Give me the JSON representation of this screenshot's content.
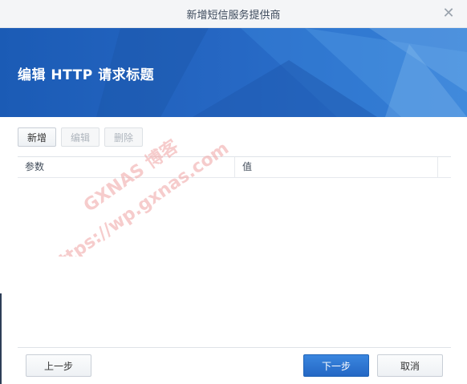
{
  "window": {
    "title": "新增短信服务提供商",
    "close_icon": "close-icon"
  },
  "banner": {
    "heading": "编辑 HTTP 请求标题"
  },
  "toolbar": {
    "add_label": "新增",
    "edit_label": "编辑",
    "delete_label": "删除"
  },
  "grid": {
    "columns": [
      "参数",
      "值"
    ],
    "rows": []
  },
  "watermark": {
    "line1": "GXNAS 博客",
    "line2": "https://wp.gxnas.com"
  },
  "footer": {
    "prev_label": "上一步",
    "next_label": "下一步",
    "cancel_label": "取消"
  },
  "colors": {
    "banner": "#2566c2",
    "primary_button": "#2a6fcb",
    "titlebar": "#f4f5f7"
  }
}
